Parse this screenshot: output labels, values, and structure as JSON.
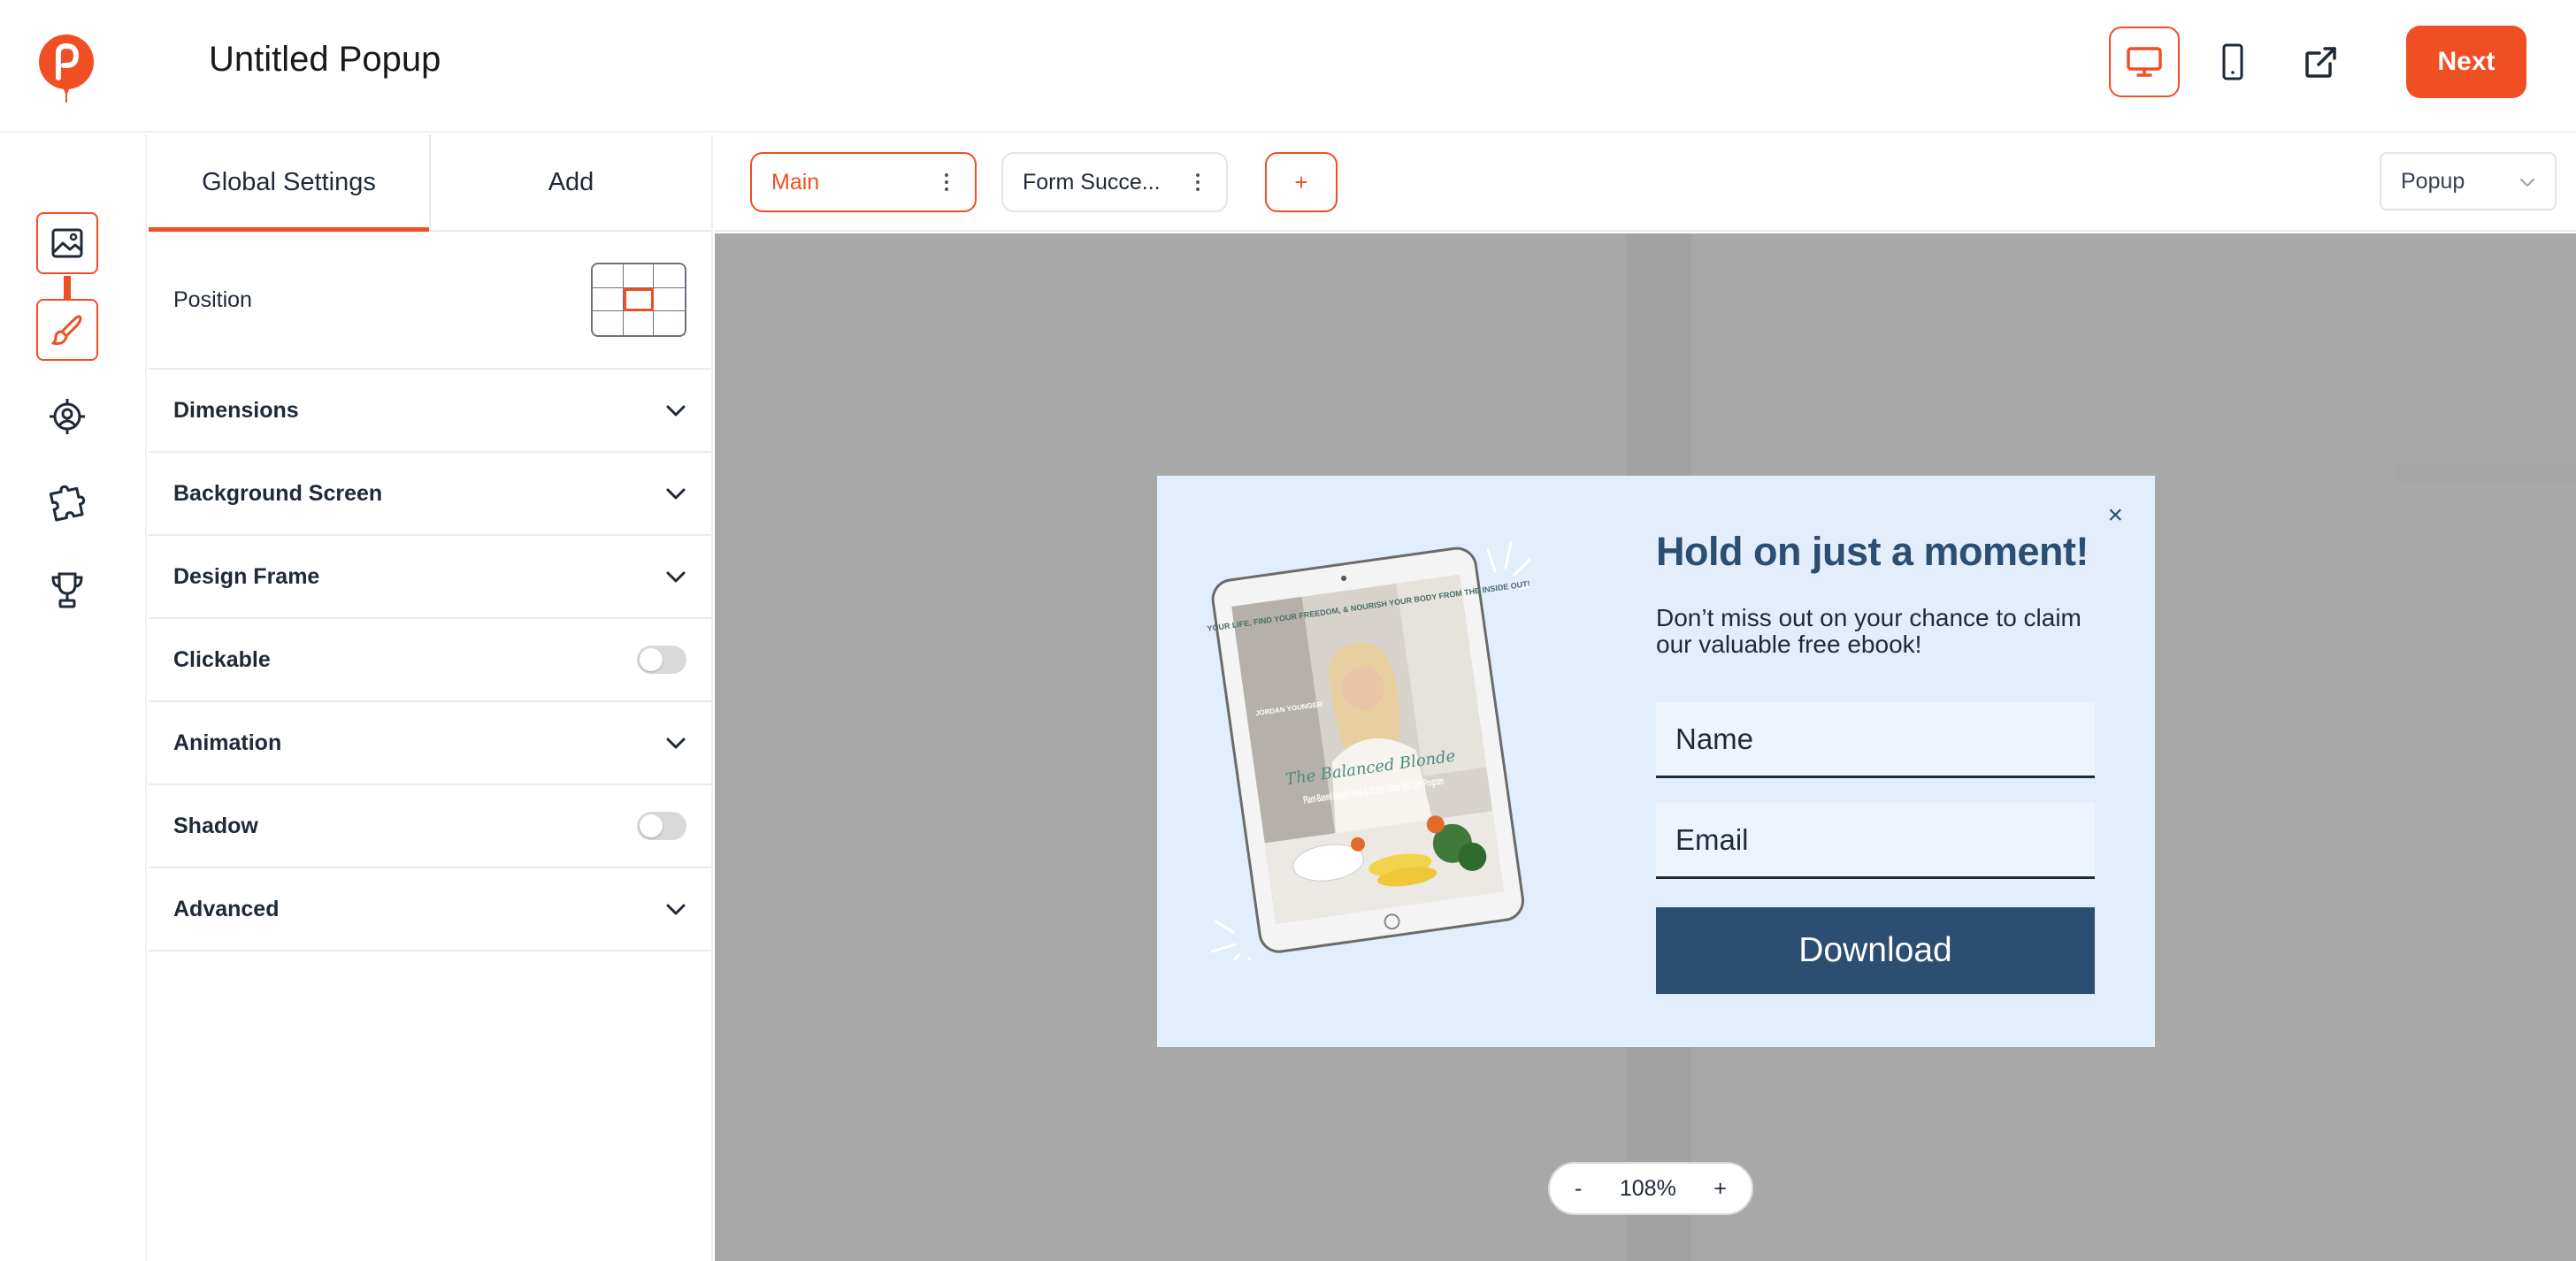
{
  "header": {
    "title": "Untitled Popup",
    "next_label": "Next"
  },
  "panel": {
    "tabs": [
      "Global Settings",
      "Add"
    ],
    "position_label": "Position",
    "rows": {
      "dimensions": "Dimensions",
      "background_screen": "Background Screen",
      "design_frame": "Design Frame",
      "clickable": "Clickable",
      "animation": "Animation",
      "shadow": "Shadow",
      "advanced": "Advanced"
    },
    "clickable_on": false,
    "shadow_on": false
  },
  "pages": {
    "tabs": [
      "Main",
      "Form Succe..."
    ],
    "add_label": "+",
    "type_selected": "Popup"
  },
  "popup": {
    "title": "Hold on just a moment!",
    "subtitle": "Don’t miss out on your chance to claim our valuable free ebook!",
    "name_placeholder": "Name",
    "email_placeholder": "Email",
    "button_label": "Download",
    "close_symbol": "×",
    "book": {
      "tagline": "ENHANCE YOUR LIFE, FIND YOUR FREEDOM, & NOURISH YOUR BODY FROM THE INSIDE OUT!",
      "author": "JORDAN YOUNGER",
      "script_title": "The Balanced Blonde",
      "title": "Plant-Based Recipe Book & 21-Day Detox Your Life Program"
    }
  },
  "zoom": {
    "minus": "-",
    "value": "108%",
    "plus": "+"
  },
  "colors": {
    "accent": "#f04e23",
    "popup_bg": "#e2eefc",
    "popup_primary": "#2c4e72",
    "canvas_bg": "#a8a8a8"
  },
  "icons": {
    "rail": [
      "image-icon",
      "brush-icon",
      "target-icon",
      "puzzle-icon",
      "trophy-icon"
    ],
    "top": [
      "desktop-icon",
      "mobile-icon",
      "external-link-icon"
    ]
  }
}
